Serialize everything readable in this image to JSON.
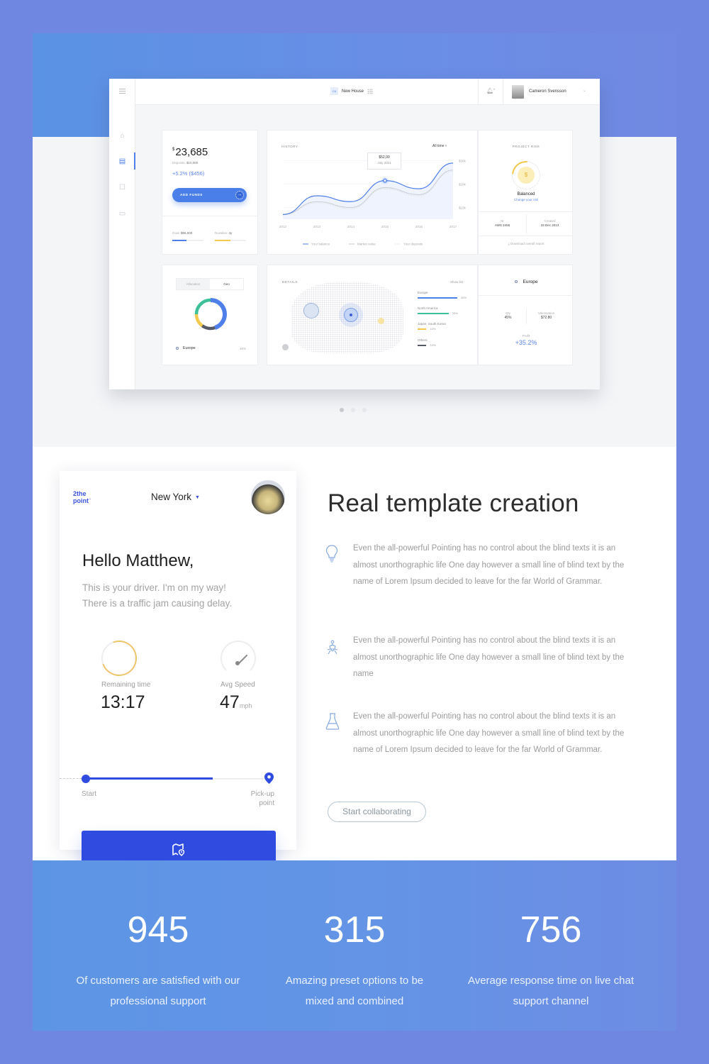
{
  "dashboard": {
    "topbar": {
      "project_badge": "CA",
      "project_name": "New House",
      "notification_count": "0",
      "user_name": "Cameron Svensson"
    },
    "sidebar": {
      "items": [
        {
          "icon": "home-icon",
          "label": "Home",
          "active": false
        },
        {
          "icon": "wallet-icon",
          "label": "Portfolio",
          "active": true
        },
        {
          "icon": "export-icon",
          "label": "Export",
          "active": false
        },
        {
          "icon": "folder-icon",
          "label": "Files",
          "active": false
        }
      ]
    },
    "balance_card": {
      "currency_symbol": "$",
      "amount": "23,685",
      "deposits_label": "Deposits:",
      "deposits_value": "$10,000",
      "change": "+5.2% ($456)",
      "add_funds_label": "ADD FUNDS",
      "goal_label": "Goal:",
      "goal_value": "$55,000",
      "goal_progress": 0.45,
      "duration_label": "Duration:",
      "duration_value": "4y",
      "duration_progress": 0.5
    },
    "history": {
      "title": "HISTORY",
      "range": "All time",
      "tooltip_value": "$52,00",
      "tooltip_date": "July 2021"
    },
    "project_risk": {
      "title": "PROJECT RISK",
      "status": "Balanced",
      "change_link": "Change your risk",
      "nr_label": "Nr",
      "nr_value": "AWS 2455",
      "created_label": "Created",
      "created_value": "22 Dec 2013",
      "download_label": "Download overall report"
    },
    "allocation": {
      "tabs": [
        "Allocation",
        "Geo"
      ],
      "active_tab": "Geo",
      "region": "Europe",
      "region_pct": "45%"
    },
    "details": {
      "title": "DETAILS",
      "show_list": "Show list",
      "regions": [
        {
          "name": "Europe",
          "pct": "45%",
          "value": 45,
          "color": "#4f7fe8"
        },
        {
          "name": "North America",
          "pct": "35%",
          "value": 35,
          "color": "#3dbf9a"
        },
        {
          "name": "Japan, South Korea",
          "pct": "10%",
          "value": 10,
          "color": "#f2c94c"
        },
        {
          "name": "Others",
          "pct": "10%",
          "value": 10,
          "color": "#555a66"
        }
      ]
    },
    "europe_card": {
      "title": "Europe",
      "qty_label": "Qty",
      "qty_value": "45%",
      "valorisation_label": "Valorisation",
      "valorisation_value": "$72.80",
      "profit_label": "Profit",
      "profit_value": "+35.2%"
    },
    "carousel": {
      "count": 3,
      "active": 0
    }
  },
  "chart_data": {
    "type": "line",
    "title": "HISTORY",
    "x": [
      "2012",
      "2013",
      "2014",
      "2015",
      "2016",
      "2017"
    ],
    "series": [
      {
        "name": "Your balance",
        "values": [
          7,
          15,
          12.5,
          21.5,
          18,
          29
        ],
        "color": "#4f7fe8"
      },
      {
        "name": "Market value",
        "values": [
          7,
          12.5,
          10,
          18.5,
          15.5,
          26
        ],
        "color": "#c8cad0"
      },
      {
        "name": "Your deposits",
        "values": [
          7,
          12,
          9.5,
          18,
          15,
          25.5
        ],
        "color": "#dfe1e6"
      }
    ],
    "y_ticks": [
      "$10k",
      "$20k",
      "$30k"
    ],
    "ylim": [
      5,
      32
    ],
    "xlabel": "",
    "ylabel": "",
    "legend": "bottom",
    "grid": true,
    "annotation": {
      "x": "2015",
      "label": "$52,00",
      "sub": "July 2021"
    }
  },
  "donut": {
    "segments": [
      {
        "name": "Europe",
        "value": 45,
        "color": "#4f7fe8"
      },
      {
        "name": "Others",
        "value": 15,
        "color": "#555a66"
      },
      {
        "name": "Japan, South Korea",
        "value": 15,
        "color": "#f2c94c"
      },
      {
        "name": "North America",
        "value": 25,
        "color": "#3dbf9a"
      }
    ]
  },
  "driver_app": {
    "logo_line1": "2the",
    "logo_line2": "point",
    "city": "New York",
    "greeting": "Hello Matthew,",
    "message_line1": "This is your driver. I'm on my way!",
    "message_line2": "There is a traffic jam causing delay.",
    "remaining_label": "Remaining time",
    "remaining_value": "13:17",
    "speed_label": "Avg Speed",
    "speed_value": "47",
    "speed_unit": "mph",
    "route_progress": 0.7,
    "start_label": "Start",
    "pickup_label_1": "Pick-up",
    "pickup_label_2": "point"
  },
  "feature_section": {
    "title": "Real template creation",
    "features": [
      {
        "icon": "lightbulb-icon",
        "text": "Even the all-powerful Pointing has no control about the blind texts it is an almost unorthographic life One day however a small line of blind text by the name of Lorem Ipsum decided to leave for the far World of Grammar."
      },
      {
        "icon": "meditation-icon",
        "text": "Even the all-powerful Pointing has no control about the blind texts it is an almost unorthographic life One day however a small line of blind text by the name"
      },
      {
        "icon": "flask-icon",
        "text": "Even the all-powerful Pointing has no control about the blind texts it is an almost unorthographic life One day however a small line of blind text by the name of Lorem Ipsum decided to leave for the far World of Grammar."
      }
    ],
    "cta": "Start collaborating"
  },
  "stats": [
    {
      "number": "945",
      "line1": "Of customers are satisfied with our",
      "line2": "professional support"
    },
    {
      "number": "315",
      "line1": "Amazing preset options to be",
      "line2": "mixed and combined"
    },
    {
      "number": "756",
      "line1": "Average response time on live chat",
      "line2": "support channel"
    }
  ]
}
